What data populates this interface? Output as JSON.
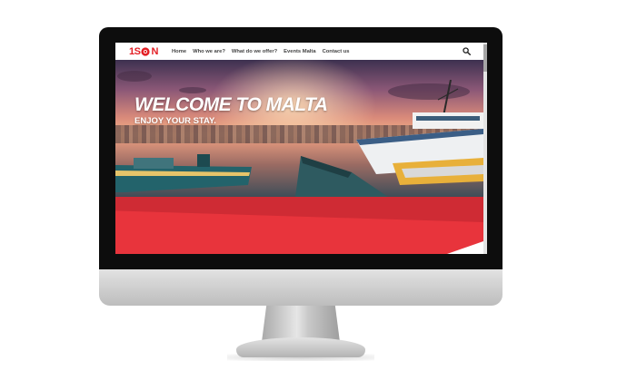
{
  "site": {
    "logo_left": "1S",
    "logo_right": "N"
  },
  "nav": {
    "items": [
      {
        "label": "Home"
      },
      {
        "label": "Who we are?"
      },
      {
        "label": "What do we offer?"
      },
      {
        "label": "Events Malta"
      },
      {
        "label": "Contact us"
      }
    ],
    "search_icon": "search-icon"
  },
  "hero": {
    "title": "WELCOME TO MALTA",
    "subtitle": "ENJOY YOUR STAY."
  },
  "colors": {
    "brand_red": "#e31e24",
    "section_red": "#e8343c",
    "nav_text": "#444444",
    "hero_text": "#ffffff"
  }
}
